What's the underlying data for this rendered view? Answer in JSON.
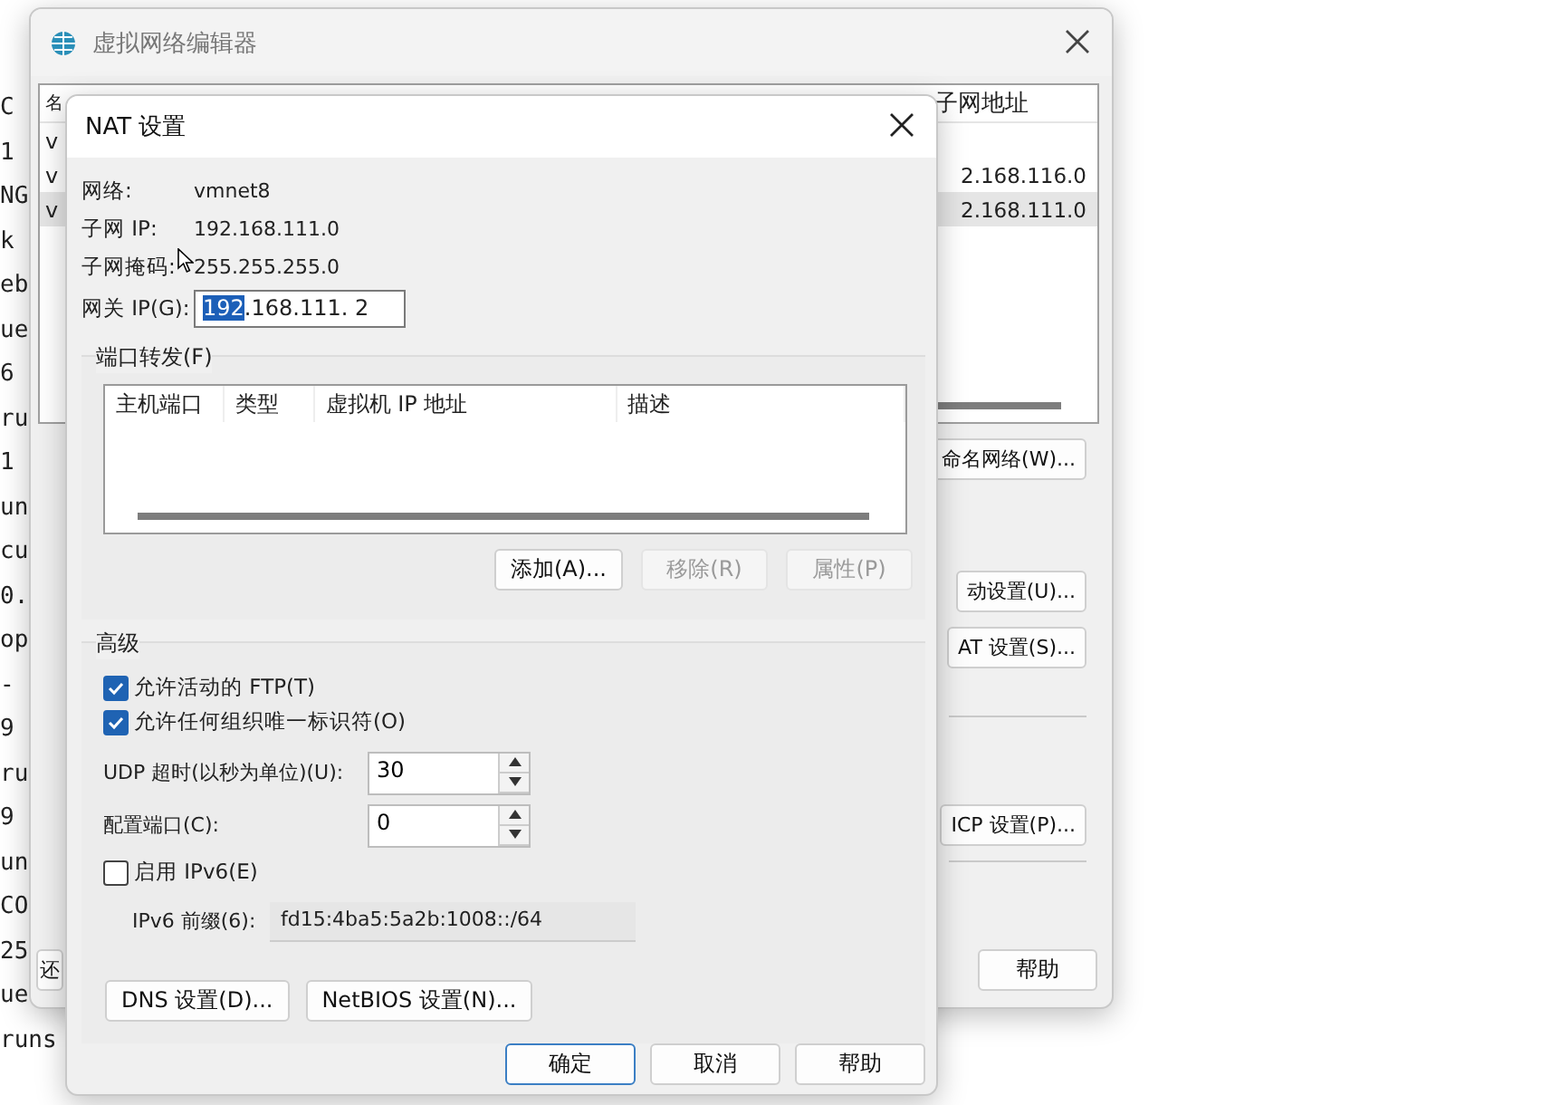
{
  "terminal": {
    "lines": [
      "C",
      "1",
      "NG",
      "k",
      "eb",
      "ue",
      "6",
      "ru",
      "1",
      "un",
      "cu",
      "0.",
      "op",
      "-",
      "9",
      "ru",
      "9",
      "un",
      "CO",
      "25",
      "ue",
      "runs"
    ]
  },
  "editor_window": {
    "title": "虚拟网络编辑器",
    "list": {
      "column_1": "名",
      "column_last": "子网地址",
      "rows": [
        {
          "name": "v",
          "selected": false
        },
        {
          "name": "v",
          "subnet": "2.168.116.0",
          "selected": false
        },
        {
          "name": "v",
          "subnet": "2.168.111.0",
          "selected": true
        }
      ]
    },
    "rename_button": "命名网络(W)...",
    "side_buttons": [
      {
        "label": "动设置(U)..."
      },
      {
        "label": "AT 设置(S)..."
      },
      {
        "label": "ICP 设置(P)..."
      }
    ],
    "bottom_left_button": "还",
    "help_button": "帮助"
  },
  "nat_dialog": {
    "title": "NAT 设置",
    "info": [
      {
        "label": "网络:",
        "value": "vmnet8"
      },
      {
        "label": "子网 IP:",
        "value": "192.168.111.0"
      },
      {
        "label": "子网掩码:",
        "value": "255.255.255.0"
      }
    ],
    "gateway": {
      "label": "网关 IP(G):",
      "segments": [
        {
          "text": "192",
          "selected": true
        },
        {
          "text": ".168",
          "selected": false
        },
        {
          "text": ".111",
          "selected": false
        },
        {
          "text": ". 2",
          "selected": false
        }
      ]
    },
    "port_forwarding": {
      "title": "端口转发(F)",
      "columns": [
        "主机端口",
        "类型",
        "虚拟机 IP 地址",
        "描述"
      ],
      "buttons": [
        {
          "label": "添加(A)...",
          "disabled": false
        },
        {
          "label": "移除(R)",
          "disabled": true
        },
        {
          "label": "属性(P)",
          "disabled": true
        }
      ]
    },
    "advanced": {
      "title": "高级",
      "checkboxes": [
        {
          "label": "允许活动的 FTP(T)",
          "checked": true
        },
        {
          "label": "允许任何组织唯一标识符(O)",
          "checked": true
        }
      ],
      "spinners": [
        {
          "label": "UDP 超时(以秒为单位)(U):",
          "value": "30"
        },
        {
          "label": "配置端口(C):",
          "value": "0"
        }
      ],
      "ipv6": {
        "label": "启用 IPv6(E)",
        "checked": false
      },
      "prefix": {
        "label": "IPv6 前缀(6):",
        "value": "fd15:4ba5:5a2b:1008::/64"
      },
      "buttons": [
        "DNS 设置(D)...",
        "NetBIOS 设置(N)..."
      ]
    },
    "buttons": [
      {
        "label": "确定",
        "default": true
      },
      {
        "label": "取消",
        "default": false
      },
      {
        "label": "帮助",
        "default": false
      }
    ]
  }
}
